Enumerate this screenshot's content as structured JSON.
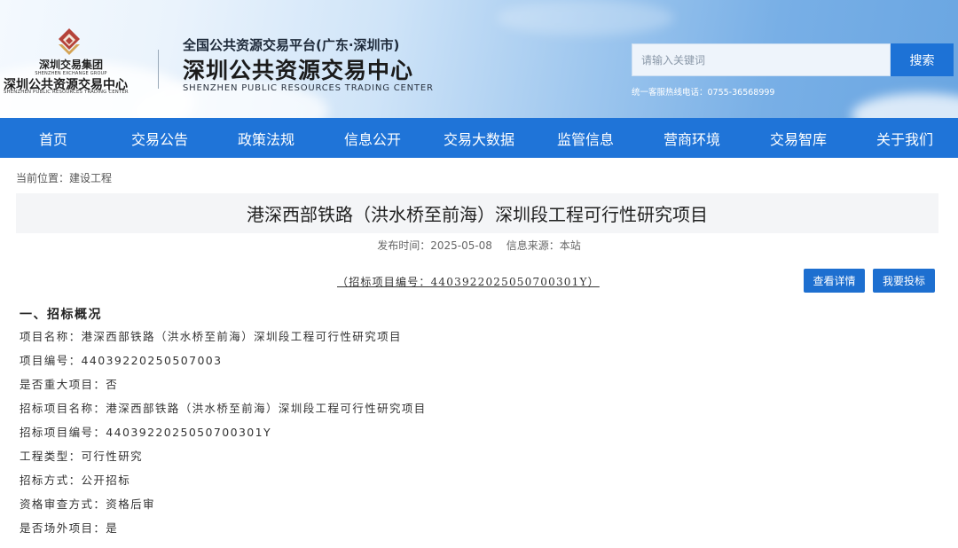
{
  "header": {
    "logo_group_cn": "深圳交易集团",
    "logo_group_en": "SHENZHEN EXCHANGE GROUP",
    "logo_center_cn": "深圳公共资源交易中心",
    "logo_center_en": "SHENZHEN PUBLIC RESOURCES TRADING CENTER",
    "platform_title": "全国公共资源交易平台(广东·深圳市)",
    "center_title": "深圳公共资源交易中心",
    "center_title_en": "SHENZHEN PUBLIC RESOURCES TRADING CENTER",
    "search_placeholder": "请输入关键词",
    "search_label": "搜索",
    "hotline": "统一客服热线电话：0755-36568999"
  },
  "nav": {
    "items": [
      "首页",
      "交易公告",
      "政策法规",
      "信息公开",
      "交易大数据",
      "监管信息",
      "营商环境",
      "交易智库",
      "关于我们"
    ]
  },
  "breadcrumb": "当前位置：建设工程",
  "article": {
    "title": "港深西部铁路（洪水桥至前海）深圳段工程可行性研究项目",
    "publish_time": "发布时间：2025-05-08",
    "source": "信息来源：本站",
    "bid_number": "（招标项目编号：44039220250507003​01Y）",
    "detail_button": "查看详情",
    "bid_button": "我要投标",
    "section_heading": "一、招标概况",
    "rows": [
      "项目名称：港深西部铁路（洪水桥至前海）深圳段工程可行性研究项目",
      "项目编号：44039220250507003",
      "是否重大项目：否",
      "招标项目名称：港深西部铁路（洪水桥至前海）深圳段工程可行性研究项目",
      "招标项目编号：4403922025050700301Y",
      "工程类型：可行性研究",
      "招标方式：公开招标",
      "资格审查方式：资格后审",
      "是否场外项目：是"
    ]
  },
  "colors": {
    "nav_bg": "#1f74d8",
    "button_bg": "#1d6fd0",
    "logo_accent": "#c0392b"
  }
}
